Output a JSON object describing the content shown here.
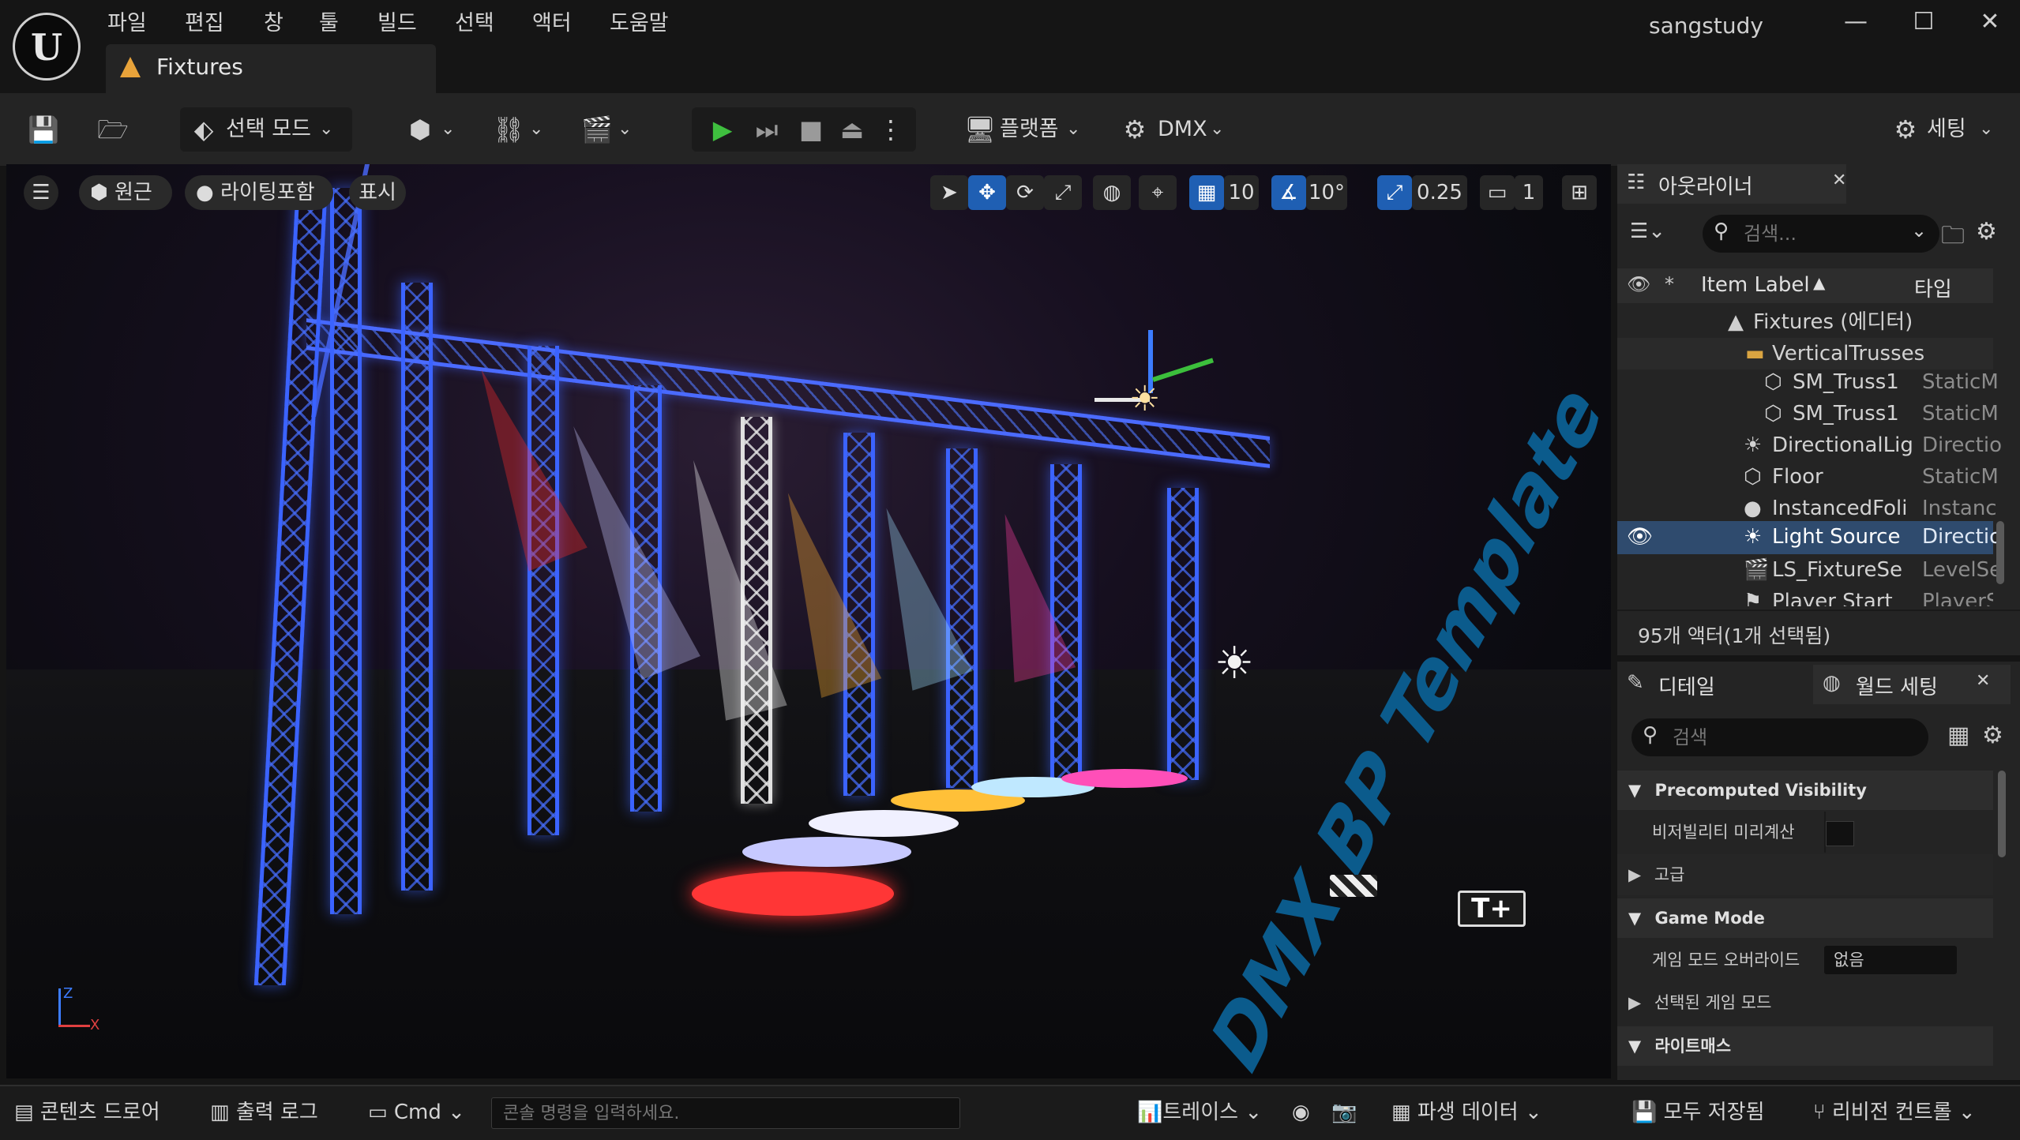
{
  "app": {
    "logo_text": "U",
    "menu": [
      "파일",
      "편집",
      "창",
      "툴",
      "빌드",
      "선택",
      "액터",
      "도움말"
    ],
    "document_tab": "Fixtures",
    "project_name": "sangstudy",
    "window_controls": {
      "minimize": "—",
      "maximize": "☐",
      "close": "✕"
    }
  },
  "toolbar": {
    "mode_label": "선택 모드",
    "platform_label": "플랫폼",
    "dmx_label": "DMX",
    "settings_label": "세팅"
  },
  "viewport": {
    "perspective_label": "원근",
    "lighting_label": "라이팅포함",
    "show_label": "표시",
    "grid_snap": "10",
    "rotation_snap": "10°",
    "scale_snap": "0.25",
    "camera_speed": "1",
    "axis": {
      "z": "Z",
      "x": "X"
    },
    "floor_text": "DMX BP Template"
  },
  "outliner": {
    "tab_title": "아웃라이너",
    "search_placeholder": "검색...",
    "col_label": "Item Label",
    "col_type": "타입",
    "rows": [
      {
        "label": "Fixtures (에디터)",
        "type": ""
      },
      {
        "label": "VerticalTrusses",
        "type": ""
      },
      {
        "label": "SM_Truss1",
        "type": "StaticM"
      },
      {
        "label": "SM_Truss1",
        "type": "StaticM"
      },
      {
        "label": "DirectionalLig",
        "type": "Directio"
      },
      {
        "label": "Floor",
        "type": "StaticM"
      },
      {
        "label": "InstancedFoli",
        "type": "Instanc"
      },
      {
        "label": "Light Source",
        "type": "Directio"
      },
      {
        "label": "LS_FixtureSe",
        "type": "LevelSe"
      },
      {
        "label": "Player Start",
        "type": "PlayerS"
      }
    ],
    "footer": "95개 액터(1개 선택됨)"
  },
  "details": {
    "tab_details": "디테일",
    "tab_world": "월드 세팅",
    "search_placeholder": "검색",
    "sections": {
      "precomputed": "Precomputed Visibility",
      "visibility_precompute": "비저빌리티 미리계산",
      "advanced": "고급",
      "game_mode": "Game Mode",
      "game_mode_override": "게임 모드 오버라이드",
      "game_mode_override_value": "없음",
      "selected_game_mode": "선택된 게임 모드",
      "lightmass": "라이트매스"
    }
  },
  "statusbar": {
    "content_drawer": "콘텐츠 드로어",
    "output_log": "출력 로그",
    "cmd": "Cmd",
    "console_placeholder": "콘솔 명령을 입력하세요.",
    "trace": "트레이스",
    "derived_data": "파생 데이터",
    "save_all": "모두 저장됨",
    "revision_control": "리비전 컨트롤"
  }
}
